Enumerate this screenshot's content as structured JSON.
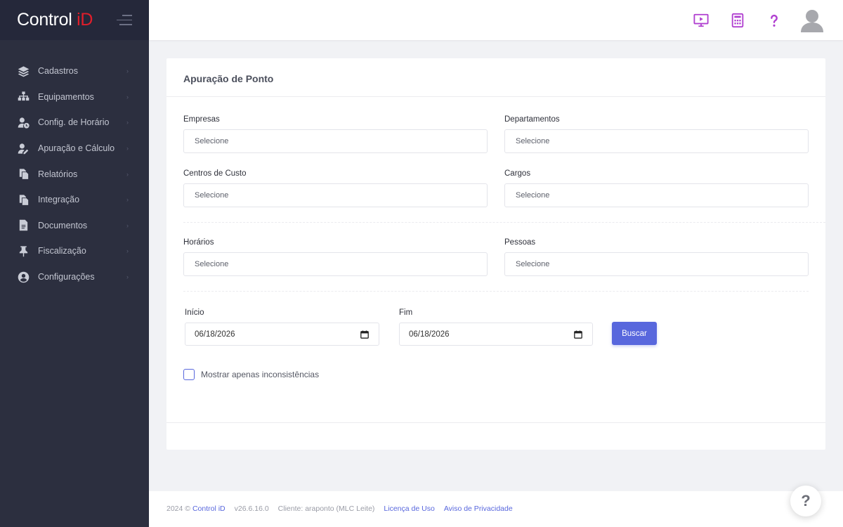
{
  "brand": {
    "name_part1": "Control ",
    "name_part2": "iD"
  },
  "sidebar": {
    "items": [
      {
        "label": "Cadastros",
        "icon": "layers-icon"
      },
      {
        "label": "Equipamentos",
        "icon": "sitemap-icon"
      },
      {
        "label": "Config. de Horário",
        "icon": "user-clock-icon"
      },
      {
        "label": "Apuração e Cálculo",
        "icon": "user-edit-icon"
      },
      {
        "label": "Relatórios",
        "icon": "copy-icon"
      },
      {
        "label": "Integração",
        "icon": "copy-icon"
      },
      {
        "label": "Documentos",
        "icon": "file-icon"
      },
      {
        "label": "Fiscalização",
        "icon": "pin-icon"
      },
      {
        "label": "Configurações",
        "icon": "user-circle-icon"
      }
    ]
  },
  "header": {
    "icons": [
      "monitor-play-icon",
      "calculator-icon",
      "question-icon",
      "avatar-icon"
    ],
    "accent": "#b03fd0"
  },
  "card": {
    "title": "Apuração de Ponto",
    "fields": {
      "empresas": {
        "label": "Empresas",
        "placeholder": "Selecione"
      },
      "departamentos": {
        "label": "Departamentos",
        "placeholder": "Selecione"
      },
      "centros": {
        "label": "Centros de Custo",
        "placeholder": "Selecione"
      },
      "cargos": {
        "label": "Cargos",
        "placeholder": "Selecione"
      },
      "horarios": {
        "label": "Horários",
        "placeholder": "Selecione"
      },
      "pessoas": {
        "label": "Pessoas",
        "placeholder": "Selecione"
      }
    },
    "inicio": {
      "label": "Início",
      "value": "06/18/2026"
    },
    "fim": {
      "label": "Fim",
      "value": "06/18/2026"
    },
    "search_button": "Buscar",
    "checkbox_label": "Mostrar apenas inconsistências"
  },
  "footer": {
    "year": "2024 ©",
    "company": "Control iD",
    "version": "v26.6.16.0",
    "client": "Cliente: araponto (MLC Leite)",
    "license": "Licença de Uso",
    "privacy": "Aviso de Privacidade"
  },
  "help_fab": "?",
  "colors": {
    "primary": "#5867dd",
    "sidebar": "#2c2f3f",
    "brand_red": "#e01e2b"
  }
}
